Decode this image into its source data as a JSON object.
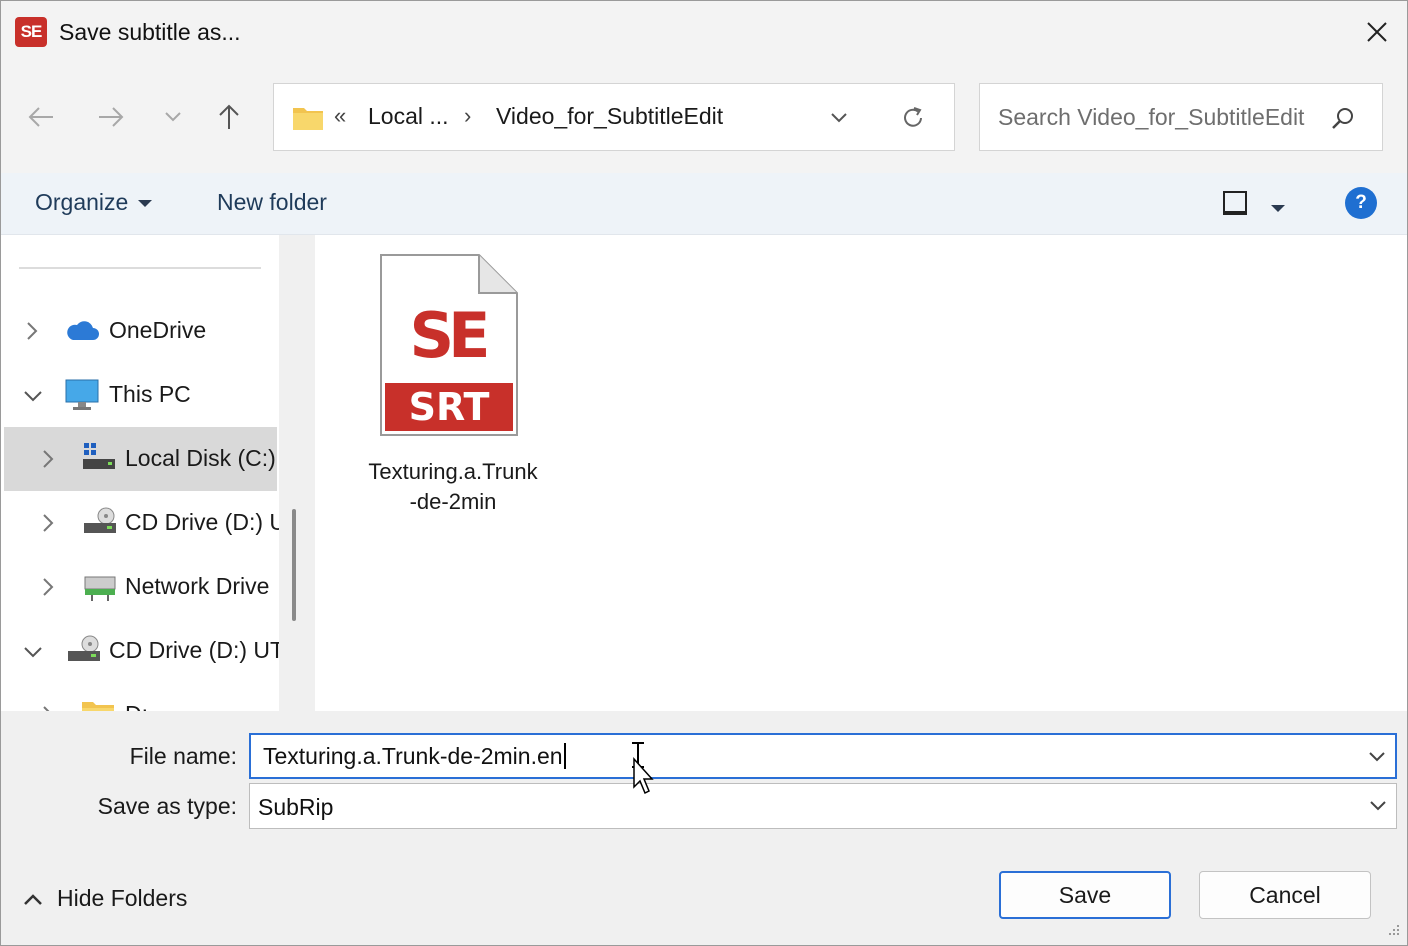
{
  "window": {
    "title": "Save subtitle as...",
    "app_icon_text": "SE"
  },
  "nav": {
    "back_icon": "arrow-left-icon",
    "forward_icon": "arrow-right-icon",
    "recent_icon": "chevron-down-icon",
    "up_icon": "arrow-up-icon"
  },
  "address": {
    "overflow": "«",
    "crumbs": [
      "Local ...",
      "Video_for_SubtitleEdit"
    ],
    "separator": "›"
  },
  "search": {
    "placeholder": "Search Video_for_SubtitleEdit"
  },
  "toolbar": {
    "organize_label": "Organize",
    "new_folder_label": "New folder",
    "help_label": "?"
  },
  "sidebar": {
    "items": [
      {
        "label": "OneDrive",
        "icon": "cloud-icon"
      },
      {
        "label": "This PC",
        "icon": "monitor-icon"
      },
      {
        "label": "Local Disk (C:)",
        "icon": "drive-icon"
      },
      {
        "label": "CD Drive (D:) U",
        "icon": "cd-drive-icon"
      },
      {
        "label": "Network Drive",
        "icon": "network-drive-icon"
      },
      {
        "label": "CD Drive (D:) UT",
        "icon": "cd-drive-icon"
      },
      {
        "label": "D:",
        "icon": "folder-icon"
      }
    ]
  },
  "files": [
    {
      "name_line1": "Texturing.a.Trunk",
      "name_line2": "-de-2min",
      "icon_badge": "SRT",
      "icon_logo": "SE"
    }
  ],
  "form": {
    "file_name_label": "File name:",
    "file_name_value": "Texturing.a.Trunk-de-2min.en",
    "save_type_label": "Save as type:",
    "save_type_value": "SubRip"
  },
  "footer": {
    "hide_folders_label": "Hide Folders",
    "save_label": "Save",
    "cancel_label": "Cancel"
  },
  "colors": {
    "accent": "#2a6fd6",
    "brand_red": "#c8302a",
    "selection": "#d9d9d9"
  }
}
